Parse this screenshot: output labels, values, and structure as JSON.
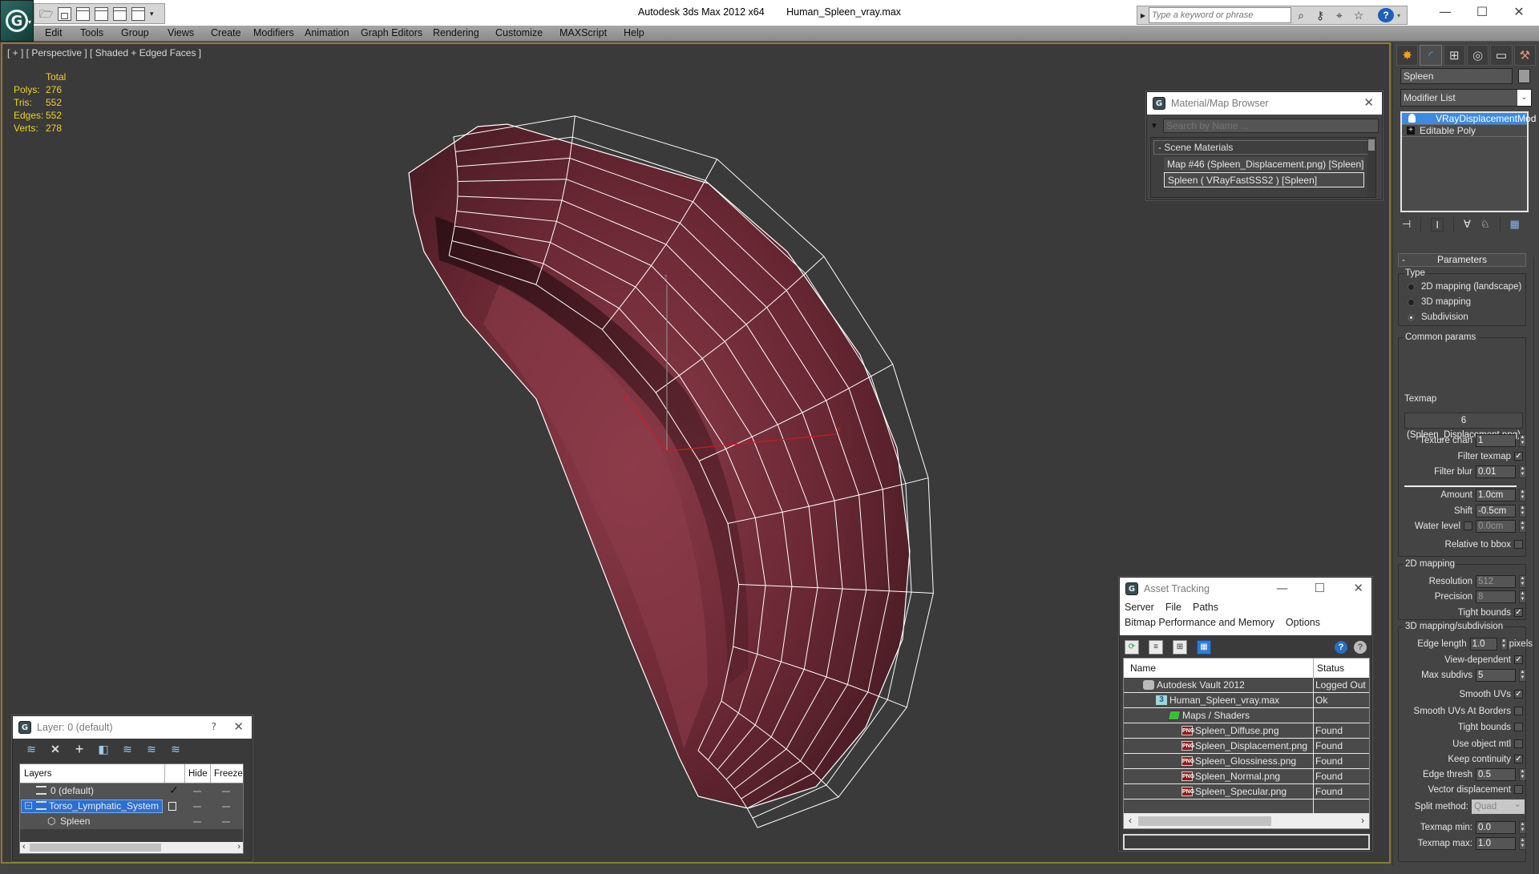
{
  "window": {
    "app_title": "Autodesk 3ds Max  2012 x64",
    "file_name": "Human_Spleen_vray.max",
    "search_placeholder": "Type a keyword or phrase",
    "controls": {
      "minimize": "—",
      "maximize": "☐",
      "close": "✕"
    }
  },
  "quick_access": {
    "icons": [
      "open-file-icon",
      "save-icon",
      "new-scene-icon",
      "project-icon",
      "undo-icon",
      "redo-icon"
    ],
    "more": "▾"
  },
  "menu": [
    "Edit",
    "Tools",
    "Group",
    "Views",
    "Create",
    "Modifiers",
    "Animation",
    "Graph Editors",
    "Rendering",
    "Customize",
    "MAXScript",
    "Help"
  ],
  "viewport": {
    "label": "[ + ] [ Perspective ] [ Shaded + Edged Faces ]",
    "stats": {
      "header": "Total",
      "rows": [
        {
          "key": "Polys:",
          "value": "276"
        },
        {
          "key": "Tris:",
          "value": "552"
        },
        {
          "key": "Edges:",
          "value": "552"
        },
        {
          "key": "Verts:",
          "value": "278"
        }
      ]
    },
    "gizmo": {
      "x": "x",
      "y": "y",
      "z": "z"
    },
    "colors": {
      "background": "#3a3a3a",
      "border": "#8c7b34",
      "stats_text": "#f2d21f",
      "model": "#6e2a35",
      "wire": "#ffffff"
    }
  },
  "material_browser": {
    "title": "Material/Map Browser",
    "search_placeholder": "Search by Name ...",
    "category": "-  Scene Materials",
    "items": [
      {
        "label": "Map #46 (Spleen_Displacement.png)  [Spleen]",
        "selected": false
      },
      {
        "label": "Spleen  ( VRayFastSSS2 )  [Spleen]",
        "selected": true
      }
    ]
  },
  "command_panel": {
    "tabs": [
      "create-tab",
      "modify-tab",
      "hierarchy-tab",
      "motion-tab",
      "display-tab",
      "utilities-tab"
    ],
    "object_name": "Spleen",
    "modifier_list": "Modifier List",
    "stack": [
      {
        "label": "VRayDisplacementMod",
        "selected": true
      },
      {
        "label": "Editable Poly",
        "selected": false
      }
    ],
    "rollout_title": "Parameters",
    "type_group": "Type",
    "type_options": [
      {
        "label": "2D mapping (landscape)",
        "checked": false
      },
      {
        "label": "3D mapping",
        "checked": false
      },
      {
        "label": "Subdivision",
        "checked": true
      }
    ],
    "common_group": "Common params",
    "texmap_label": "Texmap",
    "texmap_value": "6 (Spleen_Displacement.png)",
    "texture_chan": {
      "label": "Texture chan",
      "value": "1"
    },
    "filter_texmap": {
      "label": "Filter texmap",
      "checked": true
    },
    "filter_blur": {
      "label": "Filter blur",
      "value": "0.01"
    },
    "amount": {
      "label": "Amount",
      "value": "1.0cm"
    },
    "shift": {
      "label": "Shift",
      "value": "-0.5cm"
    },
    "water_level": {
      "label": "Water level",
      "checked": false,
      "value": "0.0cm"
    },
    "relative_bbox": {
      "label": "Relative to bbox",
      "checked": false
    },
    "mapping2d_group": "2D mapping",
    "resolution": {
      "label": "Resolution",
      "value": "512"
    },
    "precision": {
      "label": "Precision",
      "value": "8"
    },
    "tight_bounds_2d": {
      "label": "Tight bounds",
      "checked": true
    },
    "mapping3d_group": "3D mapping/subdivision",
    "edge_length": {
      "label": "Edge length",
      "value": "1.0",
      "suffix": "pixels"
    },
    "view_dependent": {
      "label": "View-dependent",
      "checked": true
    },
    "max_subdivs": {
      "label": "Max subdivs",
      "value": "5"
    },
    "smooth_uvs": {
      "label": "Smooth UVs",
      "checked": true
    },
    "smooth_uvs_borders": {
      "label": "Smooth UVs At Borders",
      "checked": false
    },
    "tight_bounds_3d": {
      "label": "Tight bounds",
      "checked": false
    },
    "use_object_mtl": {
      "label": "Use object mtl",
      "checked": false
    },
    "keep_continuity": {
      "label": "Keep continuity",
      "checked": true
    },
    "edge_thresh": {
      "label": "Edge thresh",
      "value": "0.5"
    },
    "vector_displacement": {
      "label": "Vector displacement",
      "checked": false
    },
    "split_method": {
      "label": "Split method:",
      "value": "Quad"
    },
    "texmap_min": {
      "label": "Texmap min:",
      "value": "0.0"
    },
    "texmap_max": {
      "label": "Texmap max:",
      "value": "1.0"
    }
  },
  "layer_window": {
    "title": "Layer: 0 (default)",
    "help": "?",
    "columns": [
      "Layers",
      "Hide",
      "Freeze"
    ],
    "rows": [
      {
        "name": "0 (default)",
        "current": true,
        "selected": false,
        "type": "layer"
      },
      {
        "name": "Torso_Lymphatic_System",
        "current": false,
        "selected": true,
        "type": "layer"
      },
      {
        "name": "Spleen",
        "current": false,
        "selected": false,
        "type": "object"
      }
    ]
  },
  "asset_tracking": {
    "title": "Asset Tracking",
    "menu_row1": [
      "Server",
      "File",
      "Paths"
    ],
    "menu_row2": [
      "Bitmap Performance and Memory",
      "Options"
    ],
    "columns": [
      "Name",
      "Status"
    ],
    "rows": [
      {
        "name": "Autodesk Vault 2012",
        "status": "Logged Out",
        "icon": "vault",
        "indent": 1
      },
      {
        "name": "Human_Spleen_vray.max",
        "status": "Ok",
        "icon": "max",
        "indent": 2
      },
      {
        "name": "Maps / Shaders",
        "status": "",
        "icon": "maps",
        "indent": 3
      },
      {
        "name": "Spleen_Diffuse.png",
        "status": "Found",
        "icon": "png",
        "indent": 4
      },
      {
        "name": "Spleen_Displacement.png",
        "status": "Found",
        "icon": "png",
        "indent": 4
      },
      {
        "name": "Spleen_Glossiness.png",
        "status": "Found",
        "icon": "png",
        "indent": 4
      },
      {
        "name": "Spleen_Normal.png",
        "status": "Found",
        "icon": "png",
        "indent": 4
      },
      {
        "name": "Spleen_Specular.png",
        "status": "Found",
        "icon": "png",
        "indent": 4
      }
    ]
  }
}
